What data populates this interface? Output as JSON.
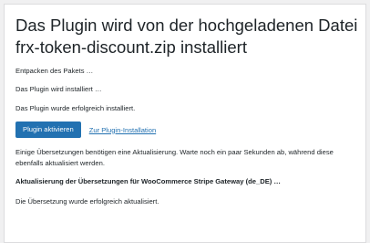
{
  "heading": "Das Plugin wird von der hochgeladenen Datei frx-token-discount.zip installiert",
  "log": {
    "unpacking": "Entpacken des Pakets …",
    "installing": "Das Plugin wird installiert …",
    "success": "Das Plugin wurde erfolgreich installiert."
  },
  "actions": {
    "activate_label": "Plugin aktivieren",
    "back_link_label": "Zur Plugin-Installation"
  },
  "translations": {
    "notice": "Einige Übersetzungen benötigen eine Aktualisierung. Warte noch ein paar Sekunden ab, während diese ebenfalls aktualisiert werden.",
    "updating_heading": "Aktualisierung der Übersetzungen für WooCommerce Stripe Gateway (de_DE) …",
    "updated_message": "Die Übersetzung wurde erfolgreich aktualisiert."
  },
  "colors": {
    "primary": "#2271b1",
    "background": "#f0f0f1",
    "panel": "#ffffff",
    "text": "#1d2327"
  }
}
